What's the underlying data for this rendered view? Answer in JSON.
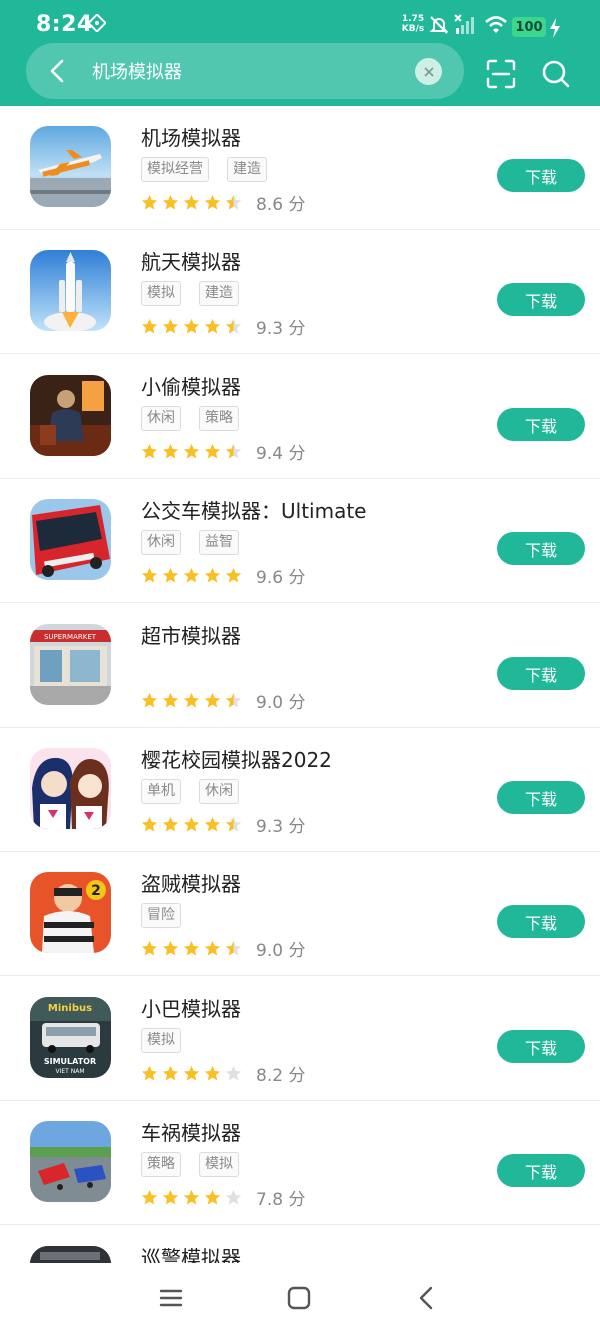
{
  "status_bar": {
    "time": "8:24",
    "net_speed_value": "1.75",
    "net_speed_unit": "KB/s",
    "battery": "100"
  },
  "search": {
    "query": "机场模拟器",
    "placeholder": ""
  },
  "colors": {
    "accent": "#21b89a",
    "star_filled": "#fbbf24",
    "star_empty": "#e0e0e0"
  },
  "apps": [
    {
      "name": "机场模拟器",
      "tags": [
        "模拟经营",
        "建造"
      ],
      "rating": 4.5,
      "score": "8.6 分",
      "button": "下载",
      "icon": "airplane-icon"
    },
    {
      "name": "航天模拟器",
      "tags": [
        "模拟",
        "建造"
      ],
      "rating": 4.5,
      "score": "9.3 分",
      "button": "下载",
      "icon": "rocket-icon"
    },
    {
      "name": "小偷模拟器",
      "tags": [
        "休闲",
        "策略"
      ],
      "rating": 4.5,
      "score": "9.4 分",
      "button": "下载",
      "icon": "thief-icon"
    },
    {
      "name": "公交车模拟器：Ultimate",
      "tags": [
        "休闲",
        "益智"
      ],
      "rating": 5,
      "score": "9.6 分",
      "button": "下载",
      "icon": "bus-icon"
    },
    {
      "name": "超市模拟器",
      "tags": [],
      "rating": 4.5,
      "score": "9.0 分",
      "button": "下载",
      "icon": "supermarket-icon"
    },
    {
      "name": "樱花校园模拟器2022",
      "tags": [
        "单机",
        "休闲"
      ],
      "rating": 4.5,
      "score": "9.3 分",
      "button": "下载",
      "icon": "anime-girls-icon"
    },
    {
      "name": "盗贼模拟器",
      "tags": [
        "冒险"
      ],
      "rating": 4.5,
      "score": "9.0 分",
      "button": "下载",
      "icon": "burglar-icon"
    },
    {
      "name": "小巴模拟器",
      "tags": [
        "模拟"
      ],
      "rating": 4,
      "score": "8.2 分",
      "button": "下载",
      "icon": "minibus-icon",
      "icon_text": [
        "Minibus",
        "SIMULATOR",
        "VIET NAM"
      ]
    },
    {
      "name": "车祸模拟器",
      "tags": [
        "策略",
        "模拟"
      ],
      "rating": 4,
      "score": "7.8 分",
      "button": "下载",
      "icon": "car-crash-icon"
    },
    {
      "name": "巡警模拟器",
      "tags": [],
      "rating": 0,
      "score": "",
      "button": "",
      "icon": "police-icon"
    }
  ]
}
